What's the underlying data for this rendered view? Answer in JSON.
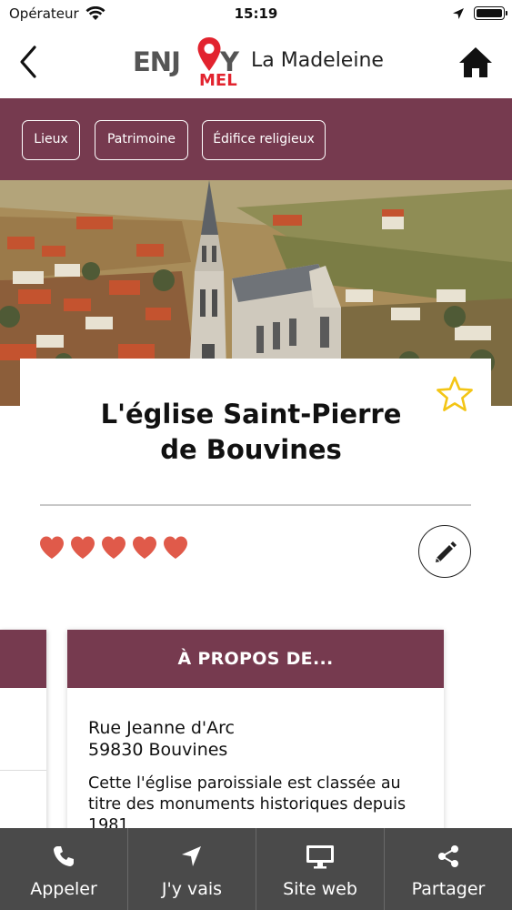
{
  "status": {
    "carrier": "Opérateur",
    "time": "15:19",
    "battery_level": 1.0
  },
  "nav": {
    "logo_left": "ENJ",
    "logo_right": "Y",
    "logo_sub": "MEL",
    "city": "La Madeleine"
  },
  "breadcrumbs": [
    "Lieux",
    "Patrimoine",
    "Édifice religieux"
  ],
  "place": {
    "title_line1": "L'église Saint-Pierre",
    "title_line2": "de Bouvines",
    "rating": 5,
    "rating_max": 5
  },
  "about": {
    "header": "À PROPOS DE...",
    "address_line1": "Rue Jeanne d'Arc",
    "address_line2": "59830 Bouvines",
    "description": "Cette l'église paroissiale est classée au titre des monuments historiques depuis 1981"
  },
  "tabs": [
    {
      "label": "Appeler",
      "icon": "phone-icon"
    },
    {
      "label": "J'y vais",
      "icon": "navigation-arrow-icon"
    },
    {
      "label": "Site web",
      "icon": "monitor-icon"
    },
    {
      "label": "Partager",
      "icon": "share-icon"
    }
  ],
  "colors": {
    "accent": "#763a4f",
    "brand_red": "#e2232e",
    "heart": "#e05a4a",
    "star": "#f3c515",
    "tabbar": "#4a4a4a"
  }
}
